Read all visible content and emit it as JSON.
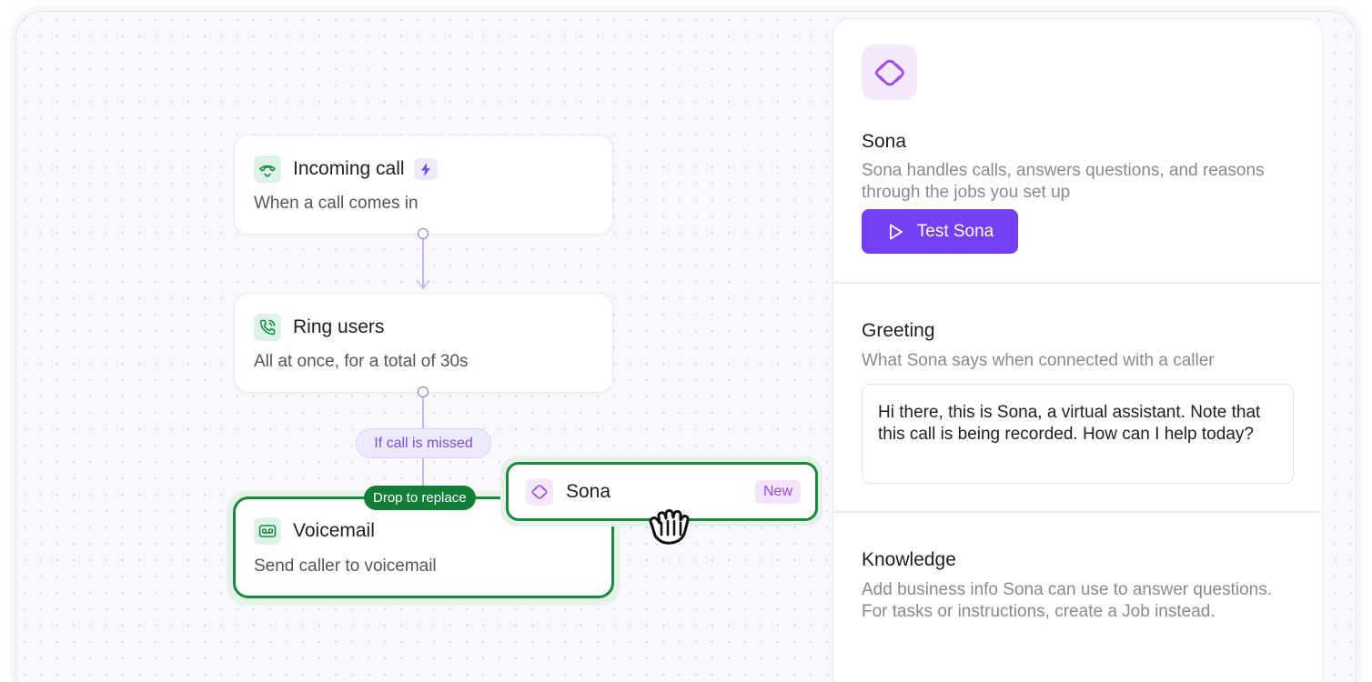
{
  "flow": {
    "incoming": {
      "title": "Incoming call",
      "subtitle": "When a call comes in",
      "icon": "incoming-call-icon",
      "badge_icon": "bolt-icon"
    },
    "ring": {
      "title": "Ring users",
      "subtitle": "All at once, for a total of 30s",
      "icon": "phone-ring-icon"
    },
    "condition_label": "If call is missed",
    "drop_label": "Drop to replace",
    "voicemail": {
      "title": "Voicemail",
      "subtitle": "Send caller to voicemail",
      "icon": "voicemail-icon"
    },
    "dragged": {
      "title": "Sona",
      "badge": "New",
      "icon": "sona-icon"
    }
  },
  "panel": {
    "name": "Sona",
    "description": "Sona handles calls, answers questions, and reasons through the jobs you set up",
    "test_button": "Test Sona",
    "greeting": {
      "title": "Greeting",
      "description": "What Sona says when connected with a caller",
      "value": "Hi there, this is Sona, a virtual assistant. Note that this call is being recorded. How can I help today?"
    },
    "knowledge": {
      "title": "Knowledge",
      "description": "Add business info Sona can use to answer questions. For tasks or instructions, create a Job instead."
    }
  },
  "colors": {
    "accent": "#7440f2",
    "success": "#178a3c",
    "icon_green_bg": "#dcf3e6",
    "icon_purple_bg": "#f4e8fd"
  }
}
